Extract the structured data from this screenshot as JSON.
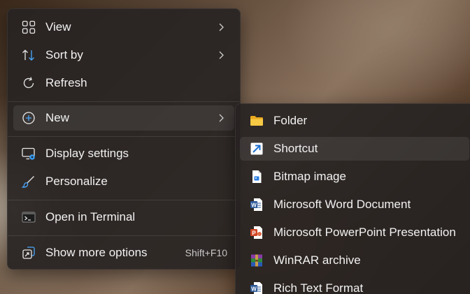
{
  "context_menu": {
    "items": [
      {
        "label": "View",
        "icon": "grid-icon",
        "has_submenu": true
      },
      {
        "label": "Sort by",
        "icon": "sort-icon",
        "has_submenu": true
      },
      {
        "label": "Refresh",
        "icon": "refresh-icon",
        "has_submenu": false
      },
      {
        "label": "New",
        "icon": "plus-circle-icon",
        "has_submenu": true,
        "highlighted": true
      },
      {
        "label": "Display settings",
        "icon": "display-settings-icon",
        "has_submenu": false
      },
      {
        "label": "Personalize",
        "icon": "brush-icon",
        "has_submenu": false
      },
      {
        "label": "Open in Terminal",
        "icon": "terminal-icon",
        "has_submenu": false
      },
      {
        "label": "Show more options",
        "icon": "more-options-icon",
        "shortcut": "Shift+F10"
      }
    ]
  },
  "new_submenu": {
    "items": [
      {
        "label": "Folder",
        "icon": "folder-icon"
      },
      {
        "label": "Shortcut",
        "icon": "shortcut-icon",
        "highlighted": true
      },
      {
        "label": "Bitmap image",
        "icon": "bitmap-icon"
      },
      {
        "label": "Microsoft Word Document",
        "icon": "word-icon"
      },
      {
        "label": "Microsoft PowerPoint Presentation",
        "icon": "powerpoint-icon"
      },
      {
        "label": "WinRAR archive",
        "icon": "winrar-icon"
      },
      {
        "label": "Rich Text Format",
        "icon": "rtf-icon"
      }
    ]
  },
  "colors": {
    "menu_background": "#282422",
    "text": "#f2f2f2",
    "accent": "#1e7fd8",
    "folder": "#f5c242",
    "word": "#2b5797",
    "powerpoint": "#d24726"
  }
}
